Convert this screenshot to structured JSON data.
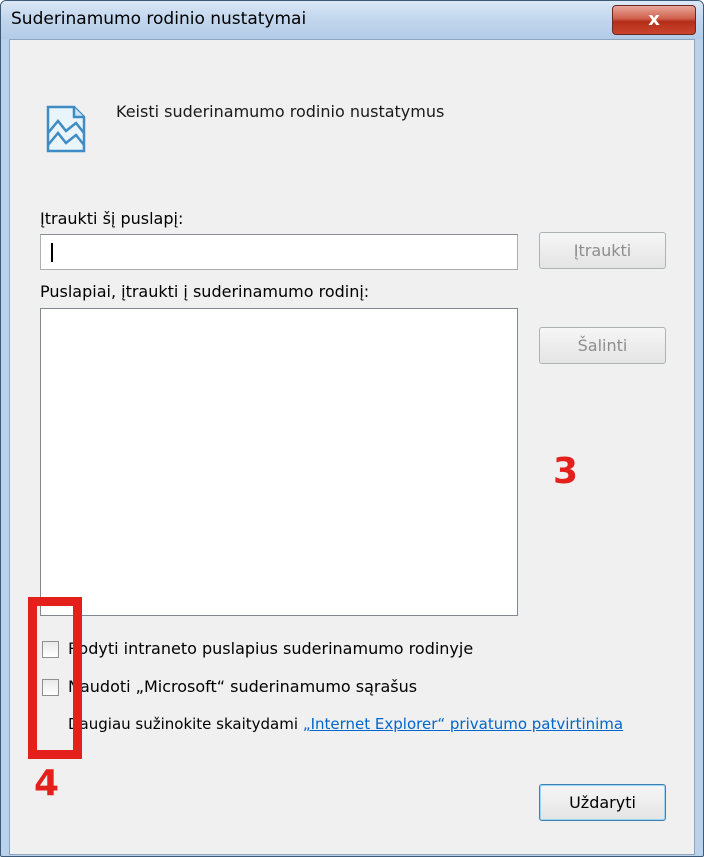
{
  "window": {
    "title": "Suderinamumo rodinio nustatymai",
    "close_label": "x"
  },
  "header": {
    "text": "Keisti suderinamumo rodinio nustatymus",
    "icon": "compatibility-view-icon"
  },
  "add_section": {
    "label": "Įtraukti šį puslapį:",
    "input_value": "",
    "add_button": "Įtraukti"
  },
  "list_section": {
    "label": "Puslapiai, įtraukti į suderinamumo rodinį:",
    "items": [],
    "remove_button": "Šalinti"
  },
  "options": {
    "intranet_label": "Rodyti intraneto puslapius suderinamumo rodinyje",
    "intranet_checked": false,
    "microsoft_lists_label": "Naudoti „Microsoft“ suderinamumo sąrašus",
    "microsoft_lists_checked": false
  },
  "privacy": {
    "text": "Daugiau sužinokite skaitydami ",
    "link": "„Internet Explorer“ privatumo patvirtinima"
  },
  "close_button": "Uždaryti",
  "annotations": {
    "three": "3",
    "four": "4",
    "color": "#e3201b"
  }
}
